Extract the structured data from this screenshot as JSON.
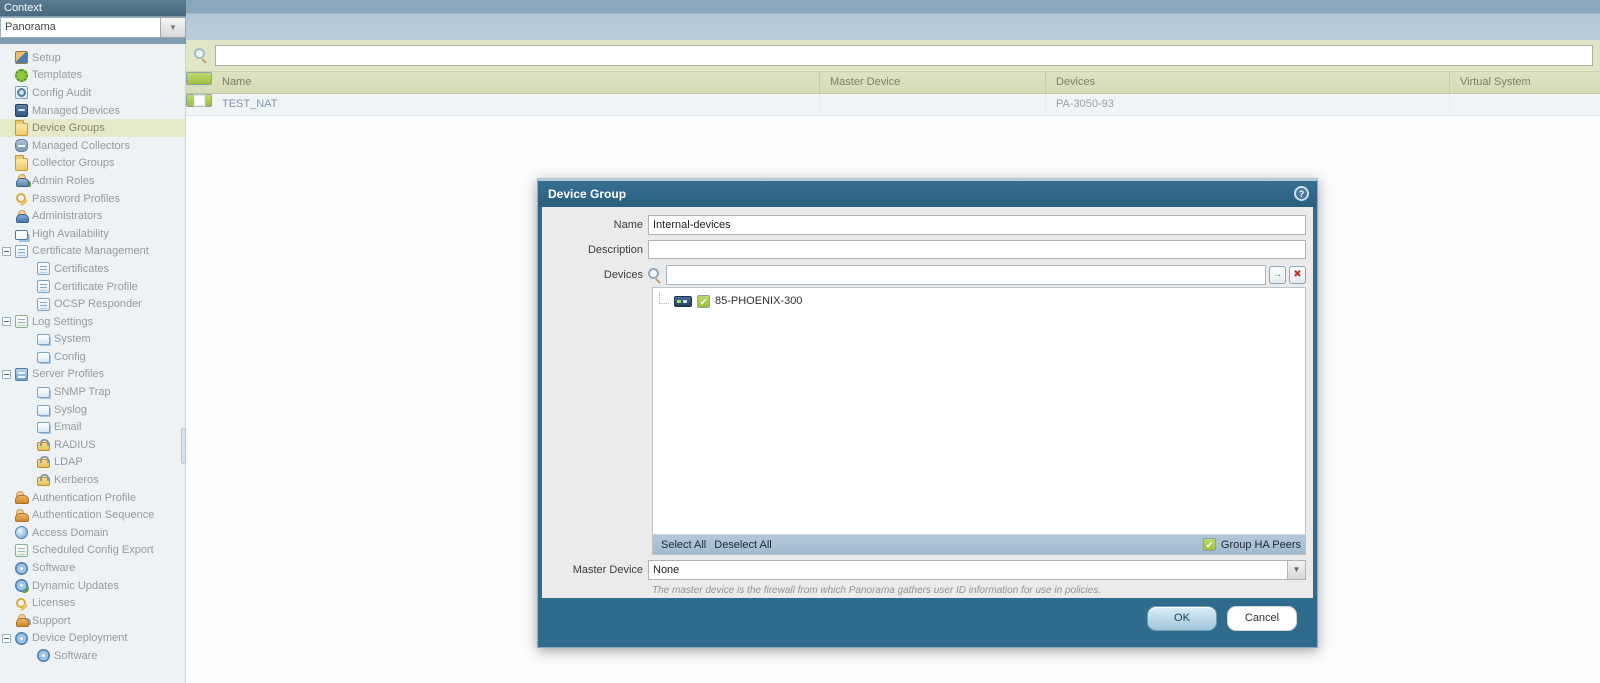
{
  "context": {
    "header": "Context",
    "selector_value": "Panorama"
  },
  "sidebar": {
    "items": [
      {
        "label": "Setup",
        "icon": "setup-icon",
        "style": "ic-tools"
      },
      {
        "label": "Templates",
        "icon": "templates-icon",
        "style": "ic-gear"
      },
      {
        "label": "Config Audit",
        "icon": "config-audit-icon",
        "style": "ic-audit"
      },
      {
        "label": "Managed Devices",
        "icon": "managed-devices-icon",
        "style": "ic-device"
      },
      {
        "label": "Device Groups",
        "icon": "device-groups-icon",
        "style": "ic-folder",
        "selected": true
      },
      {
        "label": "Managed Collectors",
        "icon": "managed-collectors-icon",
        "style": "ic-device-light"
      },
      {
        "label": "Collector Groups",
        "icon": "collector-groups-icon",
        "style": "ic-folder"
      },
      {
        "label": "Admin Roles",
        "icon": "admin-roles-icon",
        "style": "ic-person-badge"
      },
      {
        "label": "Password Profiles",
        "icon": "password-profiles-icon",
        "style": "ic-key"
      },
      {
        "label": "Administrators",
        "icon": "administrators-icon",
        "style": "ic-person"
      },
      {
        "label": "High Availability",
        "icon": "high-availability-icon",
        "style": "ic-ha"
      },
      {
        "label": "Certificate Management",
        "icon": "certificate-management-icon",
        "style": "ic-cert",
        "expand": true
      },
      {
        "label": "Certificates",
        "icon": "certificates-icon",
        "style": "ic-cert",
        "child": true
      },
      {
        "label": "Certificate Profile",
        "icon": "certificate-profile-icon",
        "style": "ic-cert",
        "child": true
      },
      {
        "label": "OCSP Responder",
        "icon": "ocsp-responder-icon",
        "style": "ic-cert",
        "child": true
      },
      {
        "label": "Log Settings",
        "icon": "log-settings-icon",
        "style": "ic-doc",
        "expand": true
      },
      {
        "label": "System",
        "icon": "system-icon",
        "style": "ic-docs",
        "child": true
      },
      {
        "label": "Config",
        "icon": "config-icon",
        "style": "ic-docs",
        "child": true
      },
      {
        "label": "Server Profiles",
        "icon": "server-profiles-icon",
        "style": "ic-server",
        "expand": true
      },
      {
        "label": "SNMP Trap",
        "icon": "snmp-trap-icon",
        "style": "ic-docs",
        "child": true
      },
      {
        "label": "Syslog",
        "icon": "syslog-icon",
        "style": "ic-docs",
        "child": true
      },
      {
        "label": "Email",
        "icon": "email-icon",
        "style": "ic-docs",
        "child": true
      },
      {
        "label": "RADIUS",
        "icon": "radius-icon",
        "style": "ic-lock",
        "child": true
      },
      {
        "label": "LDAP",
        "icon": "ldap-icon",
        "style": "ic-lock",
        "child": true
      },
      {
        "label": "Kerberos",
        "icon": "kerberos-icon",
        "style": "ic-lock",
        "child": true
      },
      {
        "label": "Authentication Profile",
        "icon": "authentication-profile-icon",
        "style": "ic-people"
      },
      {
        "label": "Authentication Sequence",
        "icon": "authentication-sequence-icon",
        "style": "ic-people"
      },
      {
        "label": "Access Domain",
        "icon": "access-domain-icon",
        "style": "ic-globe"
      },
      {
        "label": "Scheduled Config Export",
        "icon": "scheduled-config-export-icon",
        "style": "ic-doc"
      },
      {
        "label": "Software",
        "icon": "software-icon",
        "style": "ic-disk"
      },
      {
        "label": "Dynamic Updates",
        "icon": "dynamic-updates-icon",
        "style": "ic-disk-globe"
      },
      {
        "label": "Licenses",
        "icon": "licenses-icon",
        "style": "ic-key"
      },
      {
        "label": "Support",
        "icon": "support-icon",
        "style": "ic-support"
      },
      {
        "label": "Device Deployment",
        "icon": "device-deployment-icon",
        "style": "ic-disk",
        "expand": true
      },
      {
        "label": "Software",
        "icon": "software-deployment-icon",
        "style": "ic-disk",
        "child": true
      }
    ]
  },
  "main": {
    "filter": {
      "value": ""
    },
    "table": {
      "columns": [
        "Name",
        "Master Device",
        "Devices",
        "Virtual System"
      ],
      "rows": [
        {
          "name": "TEST_NAT",
          "master_device": "",
          "devices": "PA-3050-93",
          "virtual_system": ""
        }
      ]
    }
  },
  "dialog": {
    "title": "Device Group",
    "fields": {
      "name_label": "Name",
      "name_value": "Internal-devices",
      "description_label": "Description",
      "description_value": "",
      "devices_label": "Devices",
      "devices_filter_value": "",
      "master_device_label": "Master Device",
      "master_device_value": "None",
      "master_device_hint": "The master device is the firewall from which Panorama gathers user ID information for use in policies."
    },
    "device_tree": {
      "items": [
        {
          "label": "85-PHOENIX-300",
          "checked": true
        }
      ]
    },
    "tree_footer": {
      "select_all": "Select All",
      "deselect_all": "Deselect All",
      "group_ha_peers": "Group HA Peers",
      "group_ha_checked": true
    },
    "icons": {
      "go": "→",
      "clear": "✖",
      "check": "✔",
      "dropdown": "▼",
      "help": "?"
    },
    "buttons": {
      "ok": "OK",
      "cancel": "Cancel"
    }
  },
  "colors": {
    "header_teal": "#2f6b8d",
    "selected_nav": "#e6eac9",
    "table_header": "#d8ddbd",
    "checkbox_green": "#9dbf3e",
    "top_bar_blue": "#b3c7d5"
  }
}
